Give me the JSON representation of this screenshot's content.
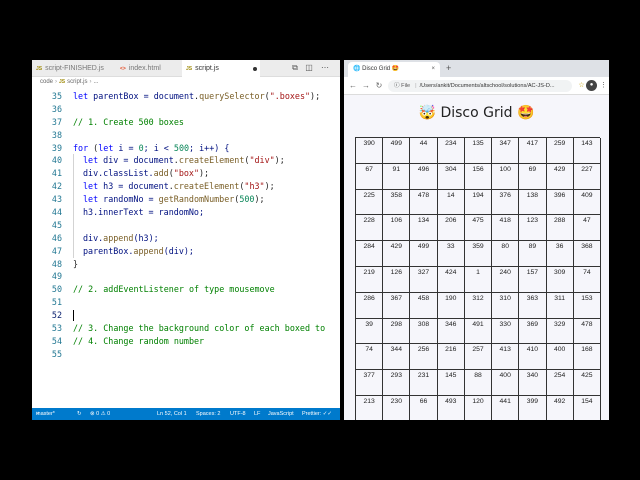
{
  "editor": {
    "tabs": [
      {
        "label": "script-FINISHED.js"
      },
      {
        "label": "index.html"
      },
      {
        "label": "script.js"
      }
    ],
    "breadcrumb": [
      "code",
      "script.js",
      "..."
    ],
    "lines": [
      {
        "n": "35"
      },
      {
        "n": "36"
      },
      {
        "n": "37"
      },
      {
        "n": "38"
      },
      {
        "n": "39"
      },
      {
        "n": "40"
      },
      {
        "n": "41"
      },
      {
        "n": "42"
      },
      {
        "n": "43"
      },
      {
        "n": "44"
      },
      {
        "n": "45"
      },
      {
        "n": "46"
      },
      {
        "n": "47"
      },
      {
        "n": "48"
      },
      {
        "n": "49"
      },
      {
        "n": "50"
      },
      {
        "n": "51"
      },
      {
        "n": "52"
      },
      {
        "n": "53"
      },
      {
        "n": "54"
      },
      {
        "n": "55"
      }
    ],
    "code": {
      "l35": [
        "let",
        " parentBox = ",
        "document",
        ".",
        "querySelector",
        "(",
        "\".boxes\"",
        ");"
      ],
      "l37": "// 1. Create 500 boxes",
      "l39": [
        "for",
        " (",
        "let",
        " i = ",
        "0",
        "; i < ",
        "500",
        "; i++) {"
      ],
      "l40": [
        "let",
        " div = ",
        "document",
        ".",
        "createElement",
        "(",
        "\"div\"",
        ");"
      ],
      "l41": [
        "div.classList.",
        "add",
        "(",
        "\"box\"",
        ");"
      ],
      "l42": [
        "let",
        " h3 = ",
        "document",
        ".",
        "createElement",
        "(",
        "\"h3\"",
        ");"
      ],
      "l43": [
        "let",
        " randomNo = ",
        "getRandomNumber",
        "(",
        "500",
        ");"
      ],
      "l44": "h3.innerText = randomNo;",
      "l46": [
        "div.",
        "append",
        "(h3);"
      ],
      "l47": [
        "parentBox.",
        "append",
        "(div);"
      ],
      "l48": "}",
      "l50": "// 2. addEventListener of type mousemove",
      "l53": "// 3. Change the background color of each boxed to",
      "l54": "// 4. Change random number"
    },
    "status": {
      "branch": "master*",
      "sync": "↻",
      "problems": "⊗ 0 ⚠ 0",
      "position": "Ln 52, Col 1",
      "spaces": "Spaces: 2",
      "encoding": "UTF-8",
      "eol": "LF",
      "language": "JavaScript",
      "prettier": "Prettier: ✓✓"
    },
    "colors": {
      "statusbar": "#007acc"
    }
  },
  "browser": {
    "tab_label": "🌐 Disco Grid 🤩",
    "tab_close": "×",
    "new_tab": "+",
    "nav": {
      "back": "←",
      "forward": "→",
      "reload": "↻"
    },
    "address": {
      "label": "File",
      "url": "/Users/ankit/Documents/altschool/solutions/AC-JS-D..."
    },
    "page_title": "🤯 Disco Grid 🤩",
    "grid": [
      [
        "390",
        "499",
        "44",
        "234",
        "135",
        "347",
        "417",
        "259",
        "143"
      ],
      [
        "67",
        "91",
        "496",
        "304",
        "156",
        "100",
        "69",
        "429",
        "227"
      ],
      [
        "225",
        "358",
        "478",
        "14",
        "194",
        "376",
        "138",
        "396",
        "409"
      ],
      [
        "228",
        "106",
        "134",
        "206",
        "475",
        "418",
        "123",
        "288",
        "47"
      ],
      [
        "284",
        "429",
        "499",
        "33",
        "359",
        "80",
        "89",
        "36",
        "368"
      ],
      [
        "219",
        "126",
        "327",
        "424",
        "1",
        "240",
        "157",
        "309",
        "74"
      ],
      [
        "286",
        "367",
        "458",
        "190",
        "312",
        "310",
        "363",
        "311",
        "153"
      ],
      [
        "39",
        "298",
        "308",
        "346",
        "491",
        "330",
        "369",
        "329",
        "478"
      ],
      [
        "74",
        "344",
        "256",
        "216",
        "257",
        "413",
        "410",
        "400",
        "168"
      ],
      [
        "377",
        "293",
        "231",
        "145",
        "88",
        "400",
        "340",
        "254",
        "425"
      ],
      [
        "213",
        "230",
        "66",
        "493",
        "120",
        "441",
        "399",
        "492",
        "154"
      ]
    ]
  }
}
